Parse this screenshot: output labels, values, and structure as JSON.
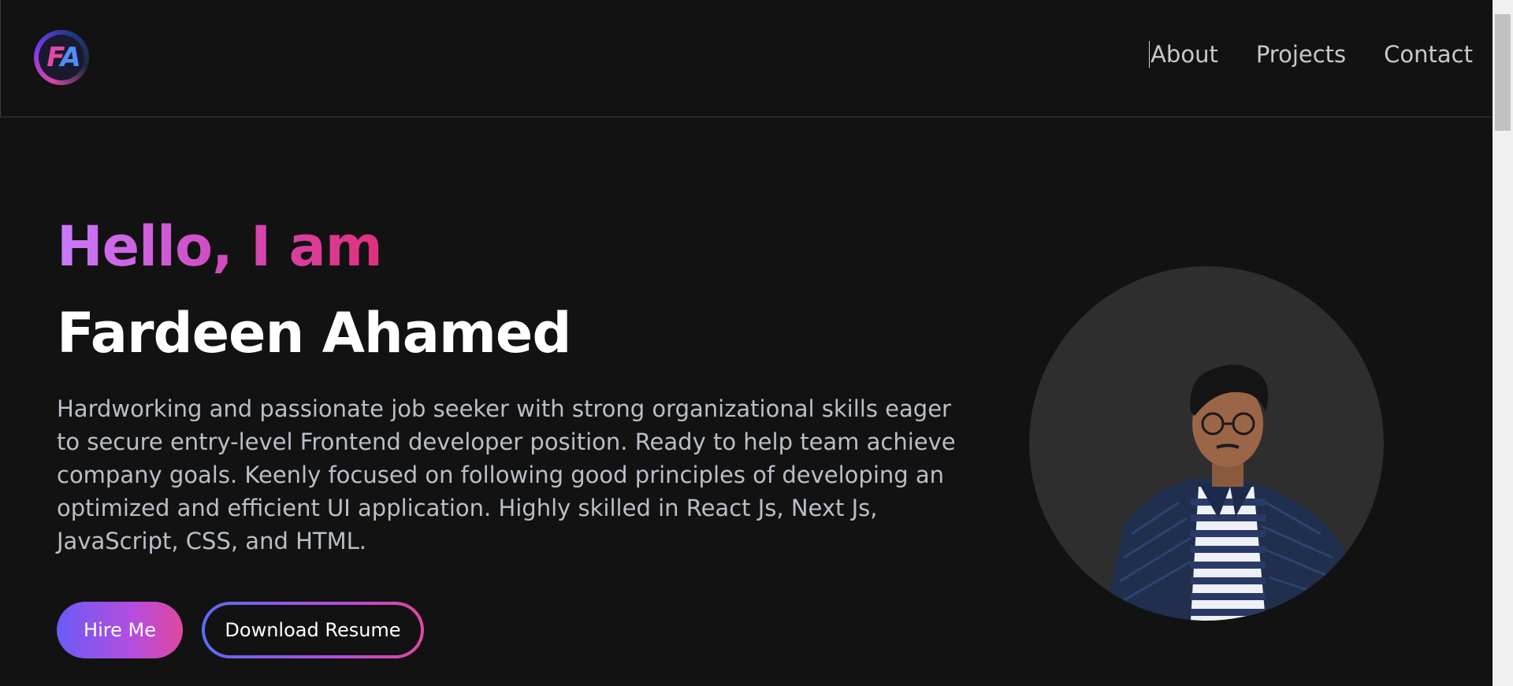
{
  "header": {
    "logo_alt": "FA",
    "nav": [
      {
        "label": "About"
      },
      {
        "label": "Projects"
      },
      {
        "label": "Contact"
      }
    ]
  },
  "hero": {
    "greeting": "Hello, I am",
    "name": "Fardeen Ahamed",
    "bio": "Hardworking and passionate job seeker with strong organizational skills eager to secure entry-level Frontend developer position. Ready to help team achieve company goals. Keenly focused on following good principles of developing an optimized and efficient UI application. Highly skilled in React Js, Next Js, JavaScript, CSS, and HTML.",
    "buttons": {
      "hire": "Hire Me",
      "resume": "Download Resume"
    }
  },
  "colors": {
    "background": "#121212",
    "accent_purple": "#c87aff",
    "accent_pink": "#e0307a",
    "accent_blue": "#5b6cf5",
    "text_muted": "#b9bfc8"
  }
}
